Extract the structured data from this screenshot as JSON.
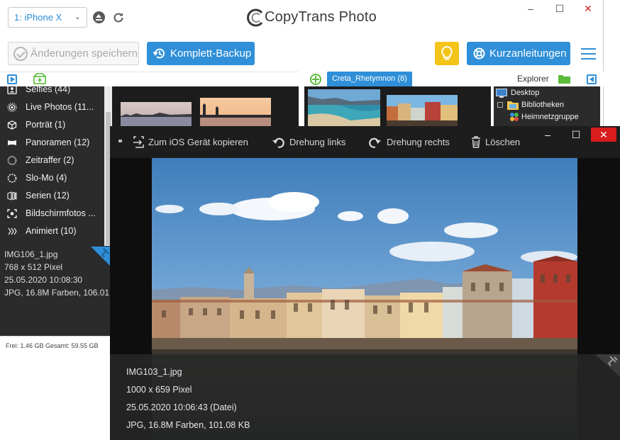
{
  "app": {
    "device": "1: iPhone X",
    "logo_text": "CopyTrans Photo",
    "window_controls": {
      "minimize": "–",
      "maximize": "☐",
      "close": "✕"
    }
  },
  "toolbar": {
    "save_label": "Änderungen speichern",
    "backup_label": "Komplett-Backup",
    "guides_label": "Kurzanleitungen"
  },
  "subbar": {
    "album_tab": "Creta_Rhetymnon (8)",
    "explorer_label": "Explorer"
  },
  "sidebar": {
    "items": [
      {
        "label": "Selfies (44)",
        "icon": "portrait-icon"
      },
      {
        "label": "Live Photos (11...",
        "icon": "live-photo-icon"
      },
      {
        "label": "Porträt (1)",
        "icon": "cube-icon"
      },
      {
        "label": "Panoramen (12)",
        "icon": "panorama-icon"
      },
      {
        "label": "Zeitraffer (2)",
        "icon": "timelapse-icon"
      },
      {
        "label": "Slo-Mo (4)",
        "icon": "slomo-icon"
      },
      {
        "label": "Serien (12)",
        "icon": "burst-icon"
      },
      {
        "label": "Bildschirmfotos ...",
        "icon": "screenshot-icon"
      },
      {
        "label": "Animiert (10)",
        "icon": "animated-icon"
      }
    ],
    "info": {
      "filename": "IMG106_1.jpg",
      "dimensions": "768 x 512 Pixel",
      "date": "25.05.2020 10:08:30",
      "format": "JPG, 16.8M Farben, 106.01"
    },
    "storage": "Frei: 1.46 GB Gesamt: 59.55 GB"
  },
  "explorer": {
    "items": [
      "Desktop",
      "Bibliotheken",
      "Heimnetzgruppe"
    ]
  },
  "viewer": {
    "tools": {
      "copy": "Zum iOS Gerät kopieren",
      "rotate_left": "Drehung links",
      "rotate_right": "Drehung rechts",
      "delete": "Löschen"
    },
    "window_controls": {
      "minimize": "–",
      "maximize": "☐",
      "close": "✕"
    },
    "info": {
      "filename": "IMG103_1.jpg",
      "dimensions": "1000 x 659 Pixel",
      "date": "25.05.2020 10:06:43  (Datei)",
      "format": "JPG, 16.8M Farben, 101.08 KB"
    }
  },
  "colors": {
    "accent": "#2f8fd8",
    "bulb": "#f4c419",
    "close_red": "#d91c1c",
    "dark_panel": "#2b2b2b"
  }
}
